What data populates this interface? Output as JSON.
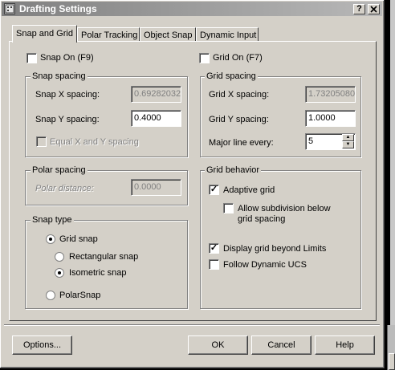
{
  "window": {
    "title": "Drafting Settings",
    "help_button": "?",
    "close_button": "X"
  },
  "tabs": [
    {
      "label": "Snap and Grid",
      "active": true
    },
    {
      "label": "Polar Tracking",
      "active": false
    },
    {
      "label": "Object Snap",
      "active": false
    },
    {
      "label": "Dynamic Input",
      "active": false
    }
  ],
  "snap": {
    "snap_on_label": "Snap On (F9)",
    "snap_on_checked": false,
    "spacing_legend": "Snap spacing",
    "x_label": "Snap X spacing:",
    "x_value": "0.69282032",
    "y_label": "Snap Y spacing:",
    "y_value": "0.4000",
    "equal_label": "Equal X and Y spacing",
    "equal_checked": false
  },
  "polar": {
    "legend": "Polar spacing",
    "distance_label": "Polar distance:",
    "distance_value": "0.0000"
  },
  "snap_type": {
    "legend": "Snap type",
    "grid_snap": "Grid snap",
    "rectangular": "Rectangular snap",
    "isometric": "Isometric snap",
    "polarsnap": "PolarSnap",
    "selected_main": "Grid snap",
    "selected_sub": "Isometric snap"
  },
  "grid": {
    "grid_on_label": "Grid On (F7)",
    "grid_on_checked": false,
    "spacing_legend": "Grid spacing",
    "x_label": "Grid X spacing:",
    "x_value": "1.73205080",
    "y_label": "Grid Y spacing:",
    "y_value": "1.0000",
    "major_label": "Major line every:",
    "major_value": "5"
  },
  "grid_behavior": {
    "legend": "Grid behavior",
    "adaptive_label": "Adaptive grid",
    "adaptive_checked": true,
    "subdivision_label_line1": "Allow subdivision below",
    "subdivision_label_line2": "grid spacing",
    "subdivision_checked": false,
    "beyond_limits_label": "Display grid beyond Limits",
    "beyond_limits_checked": true,
    "follow_ucs_label": "Follow Dynamic UCS",
    "follow_ucs_checked": false
  },
  "buttons": {
    "options": "Options...",
    "ok": "OK",
    "cancel": "Cancel",
    "help": "Help"
  },
  "icons": {
    "title_icon": "drafting-settings-icon",
    "check": "✓"
  }
}
